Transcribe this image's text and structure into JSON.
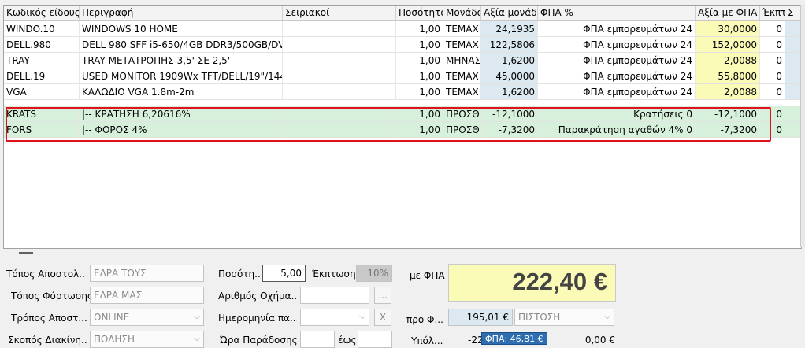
{
  "columns": [
    "Κωδικός είδους",
    "Περιγραφή",
    "Σειριακοί",
    "Ποσότητα",
    "Μονάδα",
    "Αξία μονάδ",
    "ΦΠΑ %",
    "Αξία με ΦΠΑ",
    "Έκπτ",
    "Σ"
  ],
  "rows": [
    {
      "code": "WINDO.10",
      "desc": "WINDOWS 10 HOME",
      "serial": "",
      "qty": "1,00",
      "unit": "TEMAX",
      "price": "24,1935",
      "vat": "ΦΠΑ εμπορευμάτων 24",
      "total": "30,0000",
      "disc": "0"
    },
    {
      "code": "DELL.980",
      "desc": "DELL 980 SFF i5-650/4GB DDR3/500GB/DV",
      "serial": "",
      "qty": "1,00",
      "unit": "TEMAX",
      "price": "122,5806",
      "vat": "ΦΠΑ εμπορευμάτων 24",
      "total": "152,0000",
      "disc": "0"
    },
    {
      "code": "TRAY",
      "desc": "TRAY ΜΕΤΑΤΡΟΠΗΣ 3,5' ΣΕ 2,5'",
      "serial": "",
      "qty": "1,00",
      "unit": "ΜΗΝΑΣ",
      "price": "1,6200",
      "vat": "ΦΠΑ εμπορευμάτων 24",
      "total": "2,0088",
      "disc": "0"
    },
    {
      "code": "DELL.19",
      "desc": "USED MONITOR 1909Wx TFT/DELL/19\"/144",
      "serial": "",
      "qty": "1,00",
      "unit": "TEMAX",
      "price": "45,0000",
      "vat": "ΦΠΑ εμπορευμάτων 24",
      "total": "55,8000",
      "disc": "0"
    },
    {
      "code": "VGA",
      "desc": "ΚΑΛΩΔΙΟ VGA 1.8m-2m",
      "serial": "",
      "qty": "1,00",
      "unit": "TEMAX",
      "price": "1,6200",
      "vat": "ΦΠΑ εμπορευμάτων 24",
      "total": "2,0088",
      "disc": "0"
    },
    {
      "code": "KRATS",
      "desc": "|-- ΚΡΑΤΗΣΗ 6,20616%",
      "serial": "",
      "qty": "1,00",
      "unit": "ΠΡΟΣΘ",
      "price": "-12,1000",
      "vat": "Κρατήσεις 0",
      "total": "-12,1000",
      "disc": "0"
    },
    {
      "code": "FORS",
      "desc": "|-- ΦΟΡΟΣ 4%",
      "serial": "",
      "qty": "1,00",
      "unit": "ΠΡΟΣΘ",
      "price": "-7,3200",
      "vat": "Παρακράτηση αγαθών 4% 0",
      "total": "-7,3200",
      "disc": "0"
    }
  ],
  "form": {
    "topos_apostolis_label": "Τόπος Αποστολ...",
    "topos_apostolis_value": "ΕΔΡΑ ΤΟΥΣ",
    "topos_fortosis_label": "Τόπος Φόρτωσης",
    "topos_fortosis_value": "ΕΔΡΑ ΜΑΣ",
    "tropos_apostolis_label": "Τρόπος Αποστ...",
    "tropos_apostolis_value": "ONLINE",
    "skopos_label": "Σκοπός Διακίνη...",
    "skopos_value": "ΠΩΛΗΣΗ",
    "posotita_label": "Ποσότη...",
    "posotita_value": "5,00",
    "ekptosi_label": "Έκπτωση",
    "ekptosi_value": "10%",
    "arithmos_label": "Αριθμός Οχήμα...",
    "arithmos_btn": "...",
    "imerominia_label": "Ημερομηνία πα...",
    "imerominia_clear": "X",
    "ora_label": "Ώρα Παράδοσης",
    "eos_label": "έως",
    "me_fpa_label": "με ΦΠΑ",
    "total_value": "222,40 €",
    "pro_fpa_label": "προ Φ...",
    "pro_fpa_value": "195,01 €",
    "payment_value": "ΠΙΣΤΩΣΗ",
    "ypoloipo_label": "Υπόλ...",
    "ypoloipo_value": "-22",
    "tooltip": "ΦΠΑ: 46,81 €",
    "right_value": "0,00 €"
  }
}
